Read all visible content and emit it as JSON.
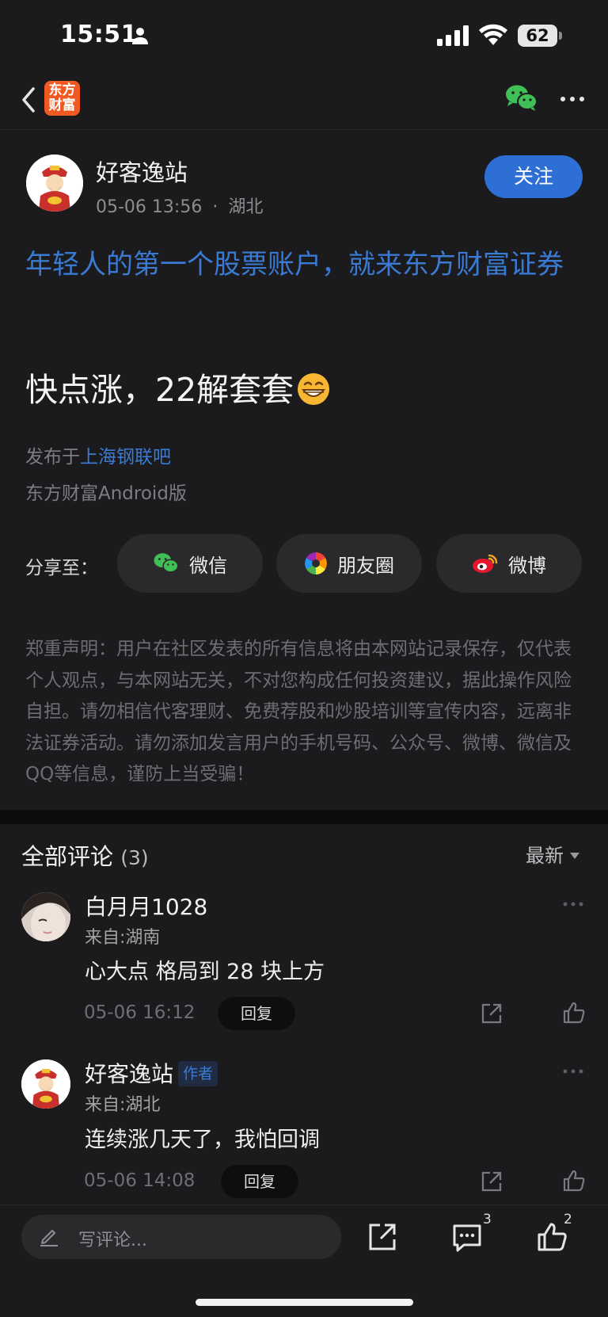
{
  "status_bar": {
    "time": "15:51",
    "battery": "62"
  },
  "nav": {
    "brand_logo_text": "东方财富",
    "icons": [
      "back-icon",
      "wechat-icon",
      "more-icon"
    ]
  },
  "post": {
    "author": "好客逸站",
    "date": "05-06 13:56",
    "separator": "·",
    "location": "湖北",
    "follow_label": "关注",
    "promo_link": "年轻人的第一个股票账户，就来东方财富证券",
    "body": "快点涨，22解套套",
    "emoji": "grinning-emoji",
    "published_prefix": "发布于",
    "forum": "上海钢联吧",
    "client": "东方财富Android版"
  },
  "share": {
    "label": "分享至：",
    "targets": [
      {
        "label": "微信",
        "icon": "wechat-icon"
      },
      {
        "label": "朋友圈",
        "icon": "moments-icon"
      },
      {
        "label": "微博",
        "icon": "weibo-icon"
      }
    ]
  },
  "disclaimer": "郑重声明：用户在社区发表的所有信息将由本网站记录保存，仅代表个人观点，与本网站无关，不对您构成任何投资建议，据此操作风险自担。请勿相信代客理财、免费荐股和炒股培训等宣传内容，远离非法证券活动。请勿添加发言用户的手机号码、公众号、微博、微信及QQ等信息，谨防上当受骗！",
  "comments_section": {
    "title": "全部评论",
    "count": "(3)",
    "sort_label": "最新",
    "comments": [
      {
        "user": "白月月1028",
        "badge": "",
        "region": "来自:湖南",
        "text": "心大点 格局到 28 块上方",
        "time": "05-06 16:12",
        "reply_label": "回复"
      },
      {
        "user": "好客逸站",
        "badge": "作者",
        "region": "来自:湖北",
        "text": "连续涨几天了，我怕回调",
        "time": "05-06 14:08",
        "reply_label": "回复"
      }
    ]
  },
  "bottom_bar": {
    "write_placeholder": "写评论...",
    "comment_count": "3",
    "like_count": "2"
  },
  "colors": {
    "background": "#1b1b1d",
    "accent_blue": "#2e6fd6",
    "link_blue": "#3a7ad3",
    "brand_orange": "#f05a22"
  }
}
